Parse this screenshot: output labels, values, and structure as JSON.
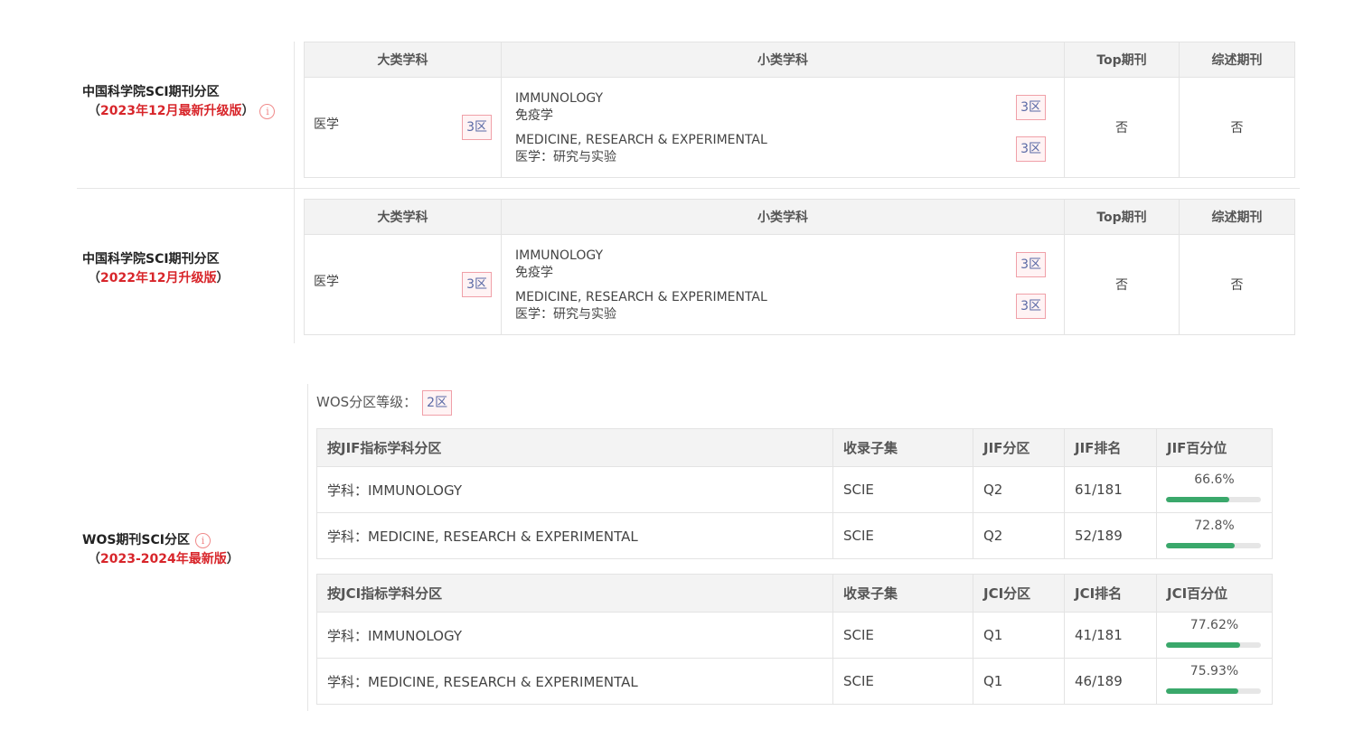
{
  "sections": {
    "cas2023": {
      "title": "中国科学院SCI期刊分区",
      "open": "（",
      "edition": "2023年12月最新升级版",
      "close": "）"
    },
    "cas2022": {
      "title": "中国科学院SCI期刊分区",
      "open": "（",
      "edition": "2022年12月升级版",
      "close": "）"
    },
    "wos": {
      "title": "WOS期刊SCI分区",
      "open": "（",
      "edition": "2023-2024年最新版",
      "close": "）"
    }
  },
  "cas_headers": {
    "major": "大类学科",
    "minor": "小类学科",
    "top": "Top期刊",
    "review": "综述期刊"
  },
  "cas_tables": [
    {
      "major": "医学",
      "major_zone": "3区",
      "minors": [
        {
          "en": "IMMUNOLOGY",
          "cn": "免疫学",
          "zone": "3区"
        },
        {
          "en": "MEDICINE, RESEARCH & EXPERIMENTAL",
          "cn": "医学：研究与实验",
          "zone": "3区"
        }
      ],
      "top": "否",
      "review": "否"
    },
    {
      "major": "医学",
      "major_zone": "3区",
      "minors": [
        {
          "en": "IMMUNOLOGY",
          "cn": "免疫学",
          "zone": "3区"
        },
        {
          "en": "MEDICINE, RESEARCH & EXPERIMENTAL",
          "cn": "医学：研究与实验",
          "zone": "3区"
        }
      ],
      "top": "否",
      "review": "否"
    }
  ],
  "wos_level": {
    "label": "WOS分区等级：",
    "zone": "2区"
  },
  "jif_table": {
    "headers": [
      "按JIF指标学科分区",
      "收录子集",
      "JIF分区",
      "JIF排名",
      "JIF百分位"
    ],
    "rows": [
      {
        "subject": "学科：IMMUNOLOGY",
        "subset": "SCIE",
        "quartile": "Q2",
        "rank": "61/181",
        "pct": "66.6%",
        "pct_value": 66.6
      },
      {
        "subject": "学科：MEDICINE, RESEARCH & EXPERIMENTAL",
        "subset": "SCIE",
        "quartile": "Q2",
        "rank": "52/189",
        "pct": "72.8%",
        "pct_value": 72.8
      }
    ]
  },
  "jci_table": {
    "headers": [
      "按JCI指标学科分区",
      "收录子集",
      "JCI分区",
      "JCI排名",
      "JCI百分位"
    ],
    "rows": [
      {
        "subject": "学科：IMMUNOLOGY",
        "subset": "SCIE",
        "quartile": "Q1",
        "rank": "41/181",
        "pct": "77.62%",
        "pct_value": 77.62
      },
      {
        "subject": "学科：MEDICINE, RESEARCH & EXPERIMENTAL",
        "subset": "SCIE",
        "quartile": "Q1",
        "rank": "46/189",
        "pct": "75.93%",
        "pct_value": 75.93
      }
    ]
  },
  "colors": {
    "accent_red": "#d8262b",
    "bar_fill": "#3aa86b",
    "zone_text": "#5a6aa6"
  },
  "icons": {
    "info": "info-circle-icon"
  }
}
